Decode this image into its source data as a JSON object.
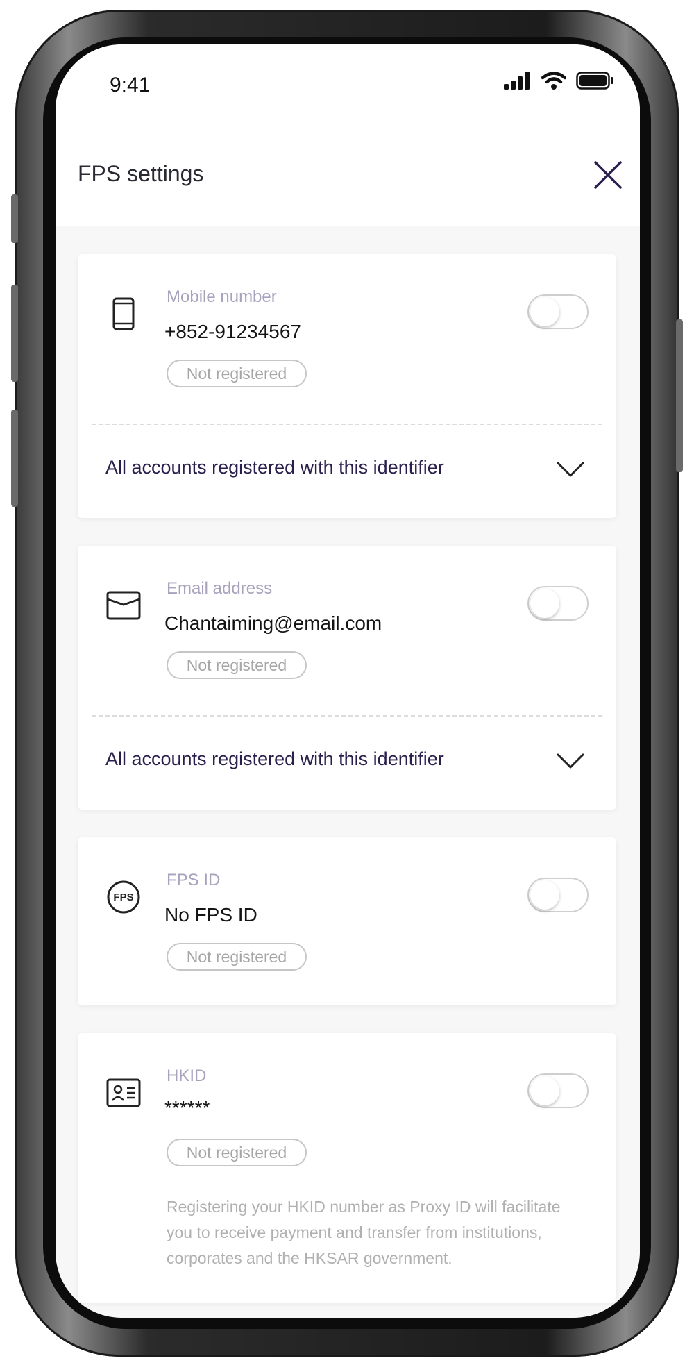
{
  "status_bar": {
    "time": "9:41"
  },
  "header": {
    "title": "FPS settings"
  },
  "cards": [
    {
      "label": "Mobile number",
      "value": "+852-91234567",
      "status": "Not registered",
      "expand_label": "All accounts registered with this identifier",
      "icon": "phone-icon"
    },
    {
      "label": "Email address",
      "value": "Chantaiming@email.com",
      "status": "Not registered",
      "expand_label": "All accounts registered with this identifier",
      "icon": "envelope-icon"
    },
    {
      "label": "FPS ID",
      "value": "No FPS ID",
      "status": "Not registered",
      "icon": "fps-icon",
      "icon_text": "FPS"
    },
    {
      "label": "HKID",
      "value": "******",
      "status": "Not registered",
      "note": "Registering your HKID number as Proxy ID will facilitate you to receive payment and transfer from institutions, corporates and the HKSAR government.",
      "icon": "id-card-icon"
    }
  ],
  "colors": {
    "accent": "#2a1e4d",
    "label": "#a9a2bd",
    "badge_border": "#c6c6c6"
  }
}
